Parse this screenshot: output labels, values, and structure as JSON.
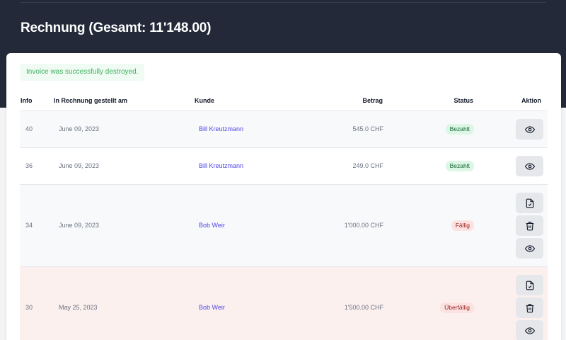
{
  "page": {
    "title": "Rechnung (Gesamt: 11'148.00)"
  },
  "alert": {
    "message": "Invoice was successfully destroyed."
  },
  "table": {
    "headers": {
      "info": "Info",
      "date": "In Rechnung gestellt am",
      "customer": "Kunde",
      "amount": "Betrag",
      "status": "Status",
      "action": "Aktion"
    },
    "rows": [
      {
        "id": "40",
        "date": "June 09, 2023",
        "customer": "Bill Kreutzmann",
        "amount": "545.0 CHF",
        "status": "Bezahlt",
        "actions": [
          "eye-icon"
        ]
      },
      {
        "id": "36",
        "date": "June 09, 2023",
        "customer": "Bill Kreutzmann",
        "amount": "249.0 CHF",
        "status": "Bezahlt",
        "actions": [
          "eye-icon"
        ]
      },
      {
        "id": "34",
        "date": "June 09, 2023",
        "customer": "Bob Weir",
        "amount": "1'000.00 CHF",
        "status": "Fällig",
        "actions": [
          "file-check-icon",
          "trash-icon",
          "eye-icon"
        ]
      },
      {
        "id": "30",
        "date": "May 25, 2023",
        "customer": "Bob Weir",
        "amount": "1'500.00 CHF",
        "status": "Überfällig",
        "actions": [
          "file-check-icon",
          "trash-icon",
          "eye-icon"
        ]
      }
    ]
  },
  "colors": {
    "header_bg": "#232938",
    "link": "#4f46e5",
    "paid_badge_bg": "#dcf7e5",
    "due_badge_bg": "#fde2e2",
    "overdue_row_bg": "#fcf0ef",
    "success_text": "#3fb25f"
  }
}
